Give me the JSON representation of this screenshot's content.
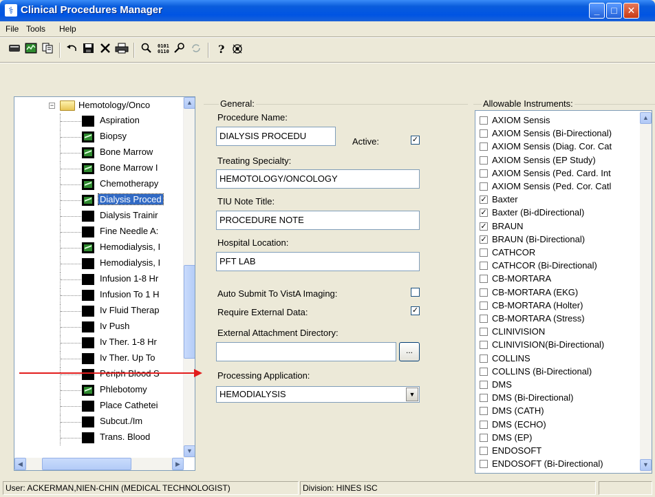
{
  "window": {
    "title": "Clinical Procedures Manager",
    "app_icon": "caduceus-icon",
    "min": "_",
    "max": "□",
    "close": "✕"
  },
  "menu": {
    "file": "File",
    "tools": "Tools",
    "help": "Help"
  },
  "toolbar": {
    "icons": [
      "card-icon",
      "chart-icon",
      "copy-icon",
      "undo-icon",
      "save-icon",
      "delete-icon",
      "print-icon",
      "search-icon",
      "binary-icon",
      "settings-icon",
      "refresh-icon",
      "help-icon",
      "debug-icon"
    ]
  },
  "tree": {
    "folder": {
      "label": "Hemotology/Onco",
      "expander": "−"
    },
    "items": [
      {
        "label": "Aspiration",
        "icon": "black"
      },
      {
        "label": "Biopsy",
        "icon": "green"
      },
      {
        "label": "Bone Marrow",
        "icon": "green"
      },
      {
        "label": "Bone Marrow I",
        "icon": "green"
      },
      {
        "label": "Chemotherapy",
        "icon": "green"
      },
      {
        "label": "Dialysis Proced",
        "icon": "green",
        "selected": true
      },
      {
        "label": "Dialysis Trainir",
        "icon": "black"
      },
      {
        "label": "Fine Needle A:",
        "icon": "black"
      },
      {
        "label": "Hemodialysis, I",
        "icon": "green"
      },
      {
        "label": "Hemodialysis, I",
        "icon": "black"
      },
      {
        "label": "Infusion 1-8 Hr",
        "icon": "black"
      },
      {
        "label": "Infusion To 1 H",
        "icon": "black"
      },
      {
        "label": "Iv Fluid Therap",
        "icon": "black"
      },
      {
        "label": "Iv Push",
        "icon": "black"
      },
      {
        "label": "Iv Ther. 1-8 Hr",
        "icon": "black"
      },
      {
        "label": "Iv Ther. Up To",
        "icon": "black"
      },
      {
        "label": "Periph Blood S",
        "icon": "black"
      },
      {
        "label": "Phlebotomy",
        "icon": "green"
      },
      {
        "label": "Place Cathetei",
        "icon": "black"
      },
      {
        "label": "Subcut./Im",
        "icon": "black"
      },
      {
        "label": "Trans. Blood",
        "icon": "black"
      }
    ]
  },
  "general": {
    "group_label": "General:",
    "procedure_name_label": "Procedure Name:",
    "procedure_name": "DIALYSIS PROCEDU",
    "active_label": "Active:",
    "active_checked": true,
    "treating_specialty_label": "Treating Specialty:",
    "treating_specialty": "HEMOTOLOGY/ONCOLOGY",
    "tiu_note_label": "TIU Note Title:",
    "tiu_note": "PROCEDURE NOTE",
    "hospital_location_label": "Hospital Location:",
    "hospital_location": "PFT LAB",
    "auto_submit_label": "Auto Submit To VistA Imaging:",
    "auto_submit_checked": false,
    "require_external_label": "Require External Data:",
    "require_external_checked": true,
    "external_dir_label": "External Attachment Directory:",
    "external_dir": "",
    "browse_label": "...",
    "processing_app_label": "Processing Application:",
    "processing_app": "HEMODIALYSIS"
  },
  "instruments": {
    "group_label": "Allowable Instruments:",
    "items": [
      {
        "label": "AXIOM Sensis",
        "checked": false
      },
      {
        "label": "AXIOM Sensis (Bi-Directional)",
        "checked": false
      },
      {
        "label": "AXIOM Sensis (Diag. Cor. Cat",
        "checked": false
      },
      {
        "label": "AXIOM Sensis (EP Study)",
        "checked": false
      },
      {
        "label": "AXIOM Sensis (Ped. Card. Int",
        "checked": false
      },
      {
        "label": "AXIOM Sensis (Ped. Cor. Catl",
        "checked": false
      },
      {
        "label": "Baxter",
        "checked": true
      },
      {
        "label": "Baxter (Bi-dDirectional)",
        "checked": true
      },
      {
        "label": "BRAUN",
        "checked": true
      },
      {
        "label": "BRAUN (Bi-Directional)",
        "checked": true
      },
      {
        "label": "CATHCOR",
        "checked": false
      },
      {
        "label": "CATHCOR (Bi-Directional)",
        "checked": false
      },
      {
        "label": "CB-MORTARA",
        "checked": false
      },
      {
        "label": "CB-MORTARA (EKG)",
        "checked": false
      },
      {
        "label": "CB-MORTARA (Holter)",
        "checked": false
      },
      {
        "label": "CB-MORTARA (Stress)",
        "checked": false
      },
      {
        "label": "CLINIVISION",
        "checked": false
      },
      {
        "label": "CLINIVISION(Bi-Directional)",
        "checked": false
      },
      {
        "label": "COLLINS",
        "checked": false
      },
      {
        "label": "COLLINS (Bi-Directional)",
        "checked": false
      },
      {
        "label": "DMS",
        "checked": false
      },
      {
        "label": "DMS (Bi-Directional)",
        "checked": false
      },
      {
        "label": "DMS (CATH)",
        "checked": false
      },
      {
        "label": "DMS (ECHO)",
        "checked": false
      },
      {
        "label": "DMS (EP)",
        "checked": false
      },
      {
        "label": "ENDOSOFT",
        "checked": false
      },
      {
        "label": "ENDOSOFT (Bi-Directional)",
        "checked": false
      }
    ]
  },
  "status": {
    "user": "User: ACKERMAN,NIEN-CHIN  (MEDICAL TECHNOLOGIST)",
    "division": "Division: HINES ISC"
  }
}
